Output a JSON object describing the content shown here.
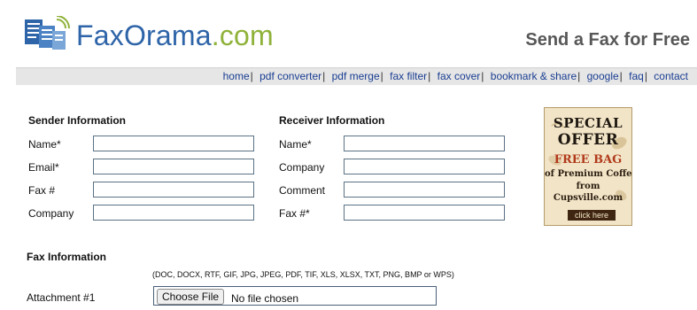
{
  "header": {
    "logo": {
      "part1": "Fax",
      "part2": "Orama",
      "part3": ".com"
    },
    "tagline": "Send a Fax for Free",
    "nav": [
      {
        "label": "home",
        "sep": "|"
      },
      {
        "label": "pdf converter",
        "sep": "|"
      },
      {
        "label": "pdf merge",
        "sep": "|"
      },
      {
        "label": "fax filter",
        "sep": "|"
      },
      {
        "label": "fax cover",
        "sep": "|"
      },
      {
        "label": "bookmark & share",
        "sep": "|"
      },
      {
        "label": "google",
        "sep": "|"
      },
      {
        "label": "faq",
        "sep": "|"
      },
      {
        "label": "contact",
        "sep": ""
      }
    ]
  },
  "sender": {
    "title": "Sender Information",
    "fields": [
      "Name*",
      "Email*",
      "Fax #",
      "Company"
    ]
  },
  "receiver": {
    "title": "Receiver Information",
    "fields": [
      "Name*",
      "Company",
      "Comment",
      "Fax #*"
    ]
  },
  "fax": {
    "title": "Fax Information",
    "formats": "(DOC, DOCX, RTF, GIF, JPG, JPEG, PDF, TIF, XLS, XLSX, TXT, PNG, BMP or WPS)",
    "attachment_label": "Attachment #1",
    "choose_file": "Choose File",
    "no_file": "No file chosen"
  },
  "ad": {
    "line1": "SPECIAL",
    "line2": "OFFER",
    "line3": "FREE BAG",
    "line4": "of Premium Coffee",
    "line5": "from",
    "line6": "Cupsville.com",
    "button": "click here"
  },
  "colors": {
    "brand_blue": "#2e64a8",
    "brand_green": "#8fb23a",
    "nav_link": "#1a3e92",
    "ad_red": "#b13a1c"
  }
}
